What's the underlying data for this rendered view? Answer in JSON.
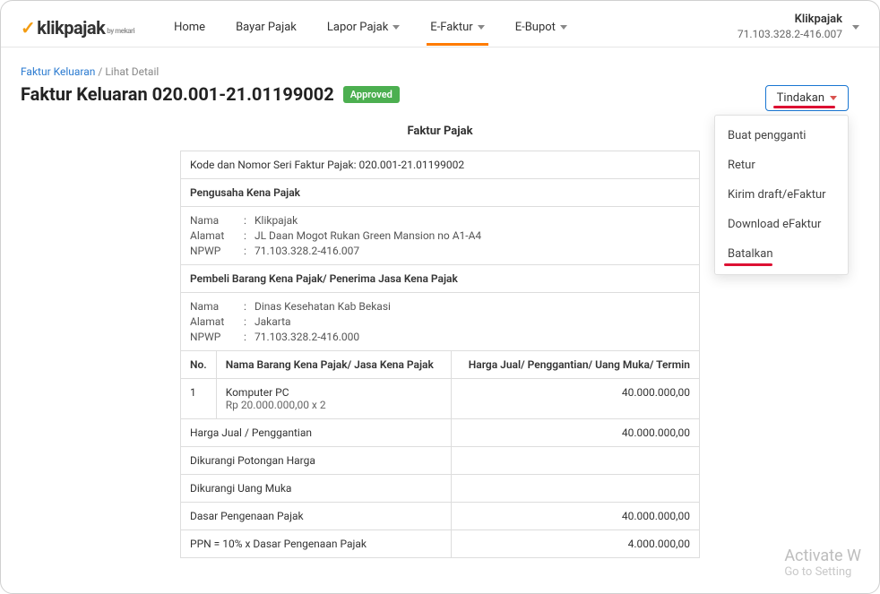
{
  "brand": {
    "name": "klikpajak",
    "subtitle": "by mekari"
  },
  "nav": {
    "home": "Home",
    "bayar": "Bayar Pajak",
    "lapor": "Lapor Pajak",
    "efaktur": "E-Faktur",
    "ebupot": "E-Bupot"
  },
  "user": {
    "name": "Klikpajak",
    "id": "71.103.328.2-416.007"
  },
  "breadcrumb": {
    "link": "Faktur Keluaran",
    "current": "Lihat Detail"
  },
  "page": {
    "title": "Faktur Keluaran 020.001-21.01199002",
    "status": "Approved"
  },
  "action": {
    "label": "Tindakan",
    "menu": [
      "Buat pengganti",
      "Retur",
      "Kirim draft/eFaktur",
      "Download eFaktur",
      "Batalkan"
    ]
  },
  "doc": {
    "heading": "Faktur Pajak",
    "serial_label": "Kode dan Nomor Seri Faktur Pajak: 020.001-21.01199002",
    "seller_head": "Pengusaha Kena Pajak",
    "seller": {
      "name_label": "Nama",
      "name": "Klikpajak",
      "addr_label": "Alamat",
      "addr": "JL Daan Mogot Rukan Green Mansion no A1-A4",
      "npwp_label": "NPWP",
      "npwp": "71.103.328.2-416.007"
    },
    "buyer_head": "Pembeli Barang Kena Pajak/ Penerima Jasa Kena Pajak",
    "buyer": {
      "name_label": "Nama",
      "name": "Dinas Kesehatan Kab Bekasi",
      "addr_label": "Alamat",
      "addr": "Jakarta",
      "npwp_label": "NPWP",
      "npwp": "71.103.328.2-416.000"
    },
    "cols": {
      "no": "No.",
      "item": "Nama Barang Kena Pajak/ Jasa Kena Pajak",
      "price": "Harga Jual/ Penggantian/ Uang Muka/ Termin"
    },
    "rows": [
      {
        "no": "1",
        "name": "Komputer PC",
        "sub": "Rp 20.000.000,00 x 2",
        "amount": "40.000.000,00"
      }
    ],
    "summary": [
      {
        "label": "Harga Jual / Penggantian",
        "amount": "40.000.000,00"
      },
      {
        "label": "Dikurangi Potongan Harga",
        "amount": ""
      },
      {
        "label": "Dikurangi Uang Muka",
        "amount": ""
      },
      {
        "label": "Dasar Pengenaan Pajak",
        "amount": "40.000.000,00"
      },
      {
        "label": "PPN = 10% x Dasar Pengenaan Pajak",
        "amount": "4.000.000,00"
      }
    ]
  },
  "watermark": {
    "line1": "Activate W",
    "line2": "Go to Setting"
  }
}
